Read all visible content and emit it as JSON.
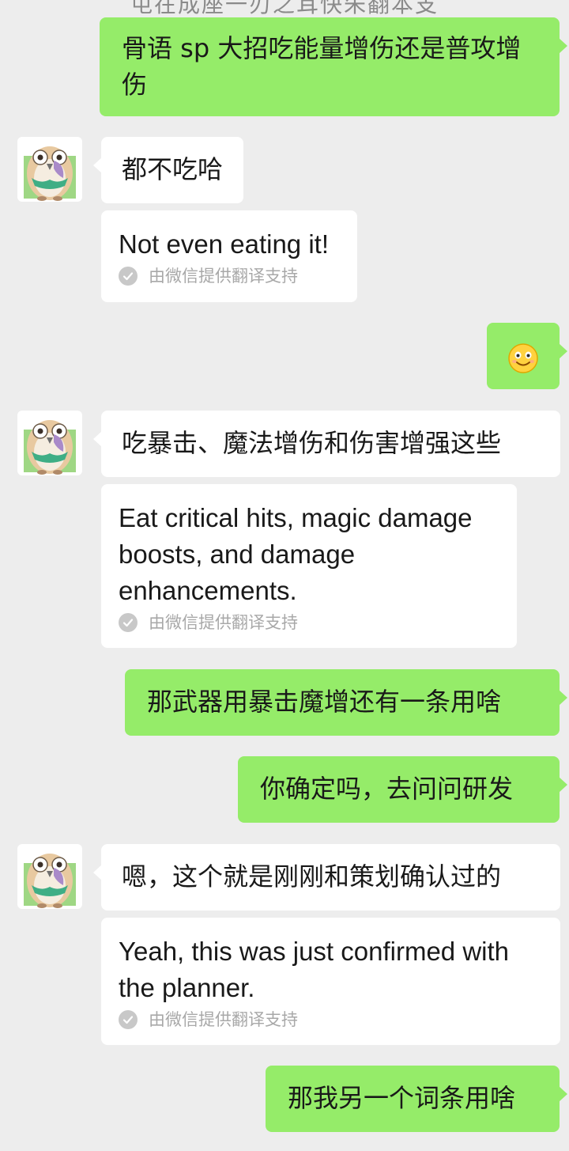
{
  "top_partial": "屯在成座一刃之耳快朱翻本支",
  "messages": [
    {
      "id": "m1",
      "side": "sent",
      "text": "骨语 sp 大招吃能量增伤还是普攻增伤"
    },
    {
      "id": "m2",
      "side": "recv",
      "text": "都不吃哈",
      "translation": "Not even eating it!",
      "translation_note": "由微信提供翻译支持"
    },
    {
      "id": "m3",
      "side": "sent",
      "emoji": "smile-emoji"
    },
    {
      "id": "m4",
      "side": "recv",
      "text": "吃暴击、魔法增伤和伤害增强这些",
      "translation": "Eat critical hits, magic damage boosts, and damage enhancements.",
      "translation_note": "由微信提供翻译支持"
    },
    {
      "id": "m5",
      "side": "sent",
      "text": "那武器用暴击魔增还有一条用啥"
    },
    {
      "id": "m6",
      "side": "sent",
      "text": "你确定吗，去问问研发"
    },
    {
      "id": "m7",
      "side": "recv",
      "text": "嗯，这个就是刚刚和策划确认过的",
      "translation": "Yeah, this was just confirmed with the planner.",
      "translation_note": "由微信提供翻译支持"
    },
    {
      "id": "m8",
      "side": "sent",
      "text": "那我另一个词条用啥"
    }
  ],
  "colors": {
    "background": "#ededed",
    "sent_bubble": "#95ec69",
    "recv_bubble": "#ffffff",
    "note_text": "#a8a8a8"
  },
  "icons": {
    "avatar": "owl-avatar-icon",
    "translation_check": "check-circle-icon"
  }
}
